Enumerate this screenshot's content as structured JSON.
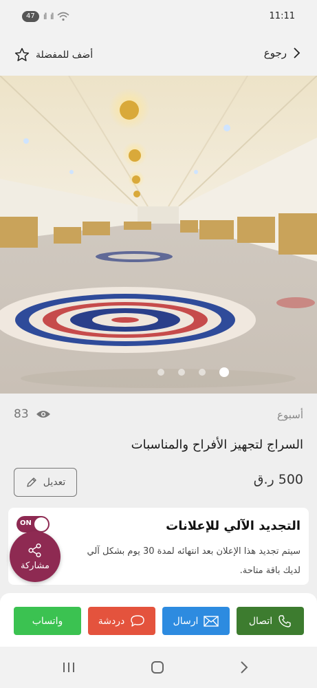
{
  "status": {
    "time": "11:11",
    "battery": "47"
  },
  "header": {
    "back_label": "رجوع",
    "favorite_label": "أضف للمفضلة"
  },
  "gallery": {
    "slide_count": 4,
    "active_slide": 4
  },
  "listing": {
    "duration": "أسبوع",
    "views": "83",
    "title": "السراج لتجهيز الأفراح والمناسبات",
    "price": "500 ر.ق",
    "edit_label": "تعديل"
  },
  "auto_renew": {
    "title": "التجديد الآلي للإعلانات",
    "description_line1": "سيتم تجديد هذا الإعلان بعد انتهائه لمدة 30 يوم بشكل آلي",
    "description_line2": "لديك باقة متاحة.",
    "toggle_label": "ON",
    "enabled": true
  },
  "share": {
    "label": "مشاركة"
  },
  "actions": {
    "call": "اتصال",
    "message": "ارسال",
    "chat": "دردشة",
    "whatsapp": "واتساب"
  },
  "colors": {
    "brand": "#8e2a52",
    "call": "#3d7c2f",
    "message": "#2d8be0",
    "chat": "#e4533d",
    "whatsapp": "#3bc251"
  }
}
